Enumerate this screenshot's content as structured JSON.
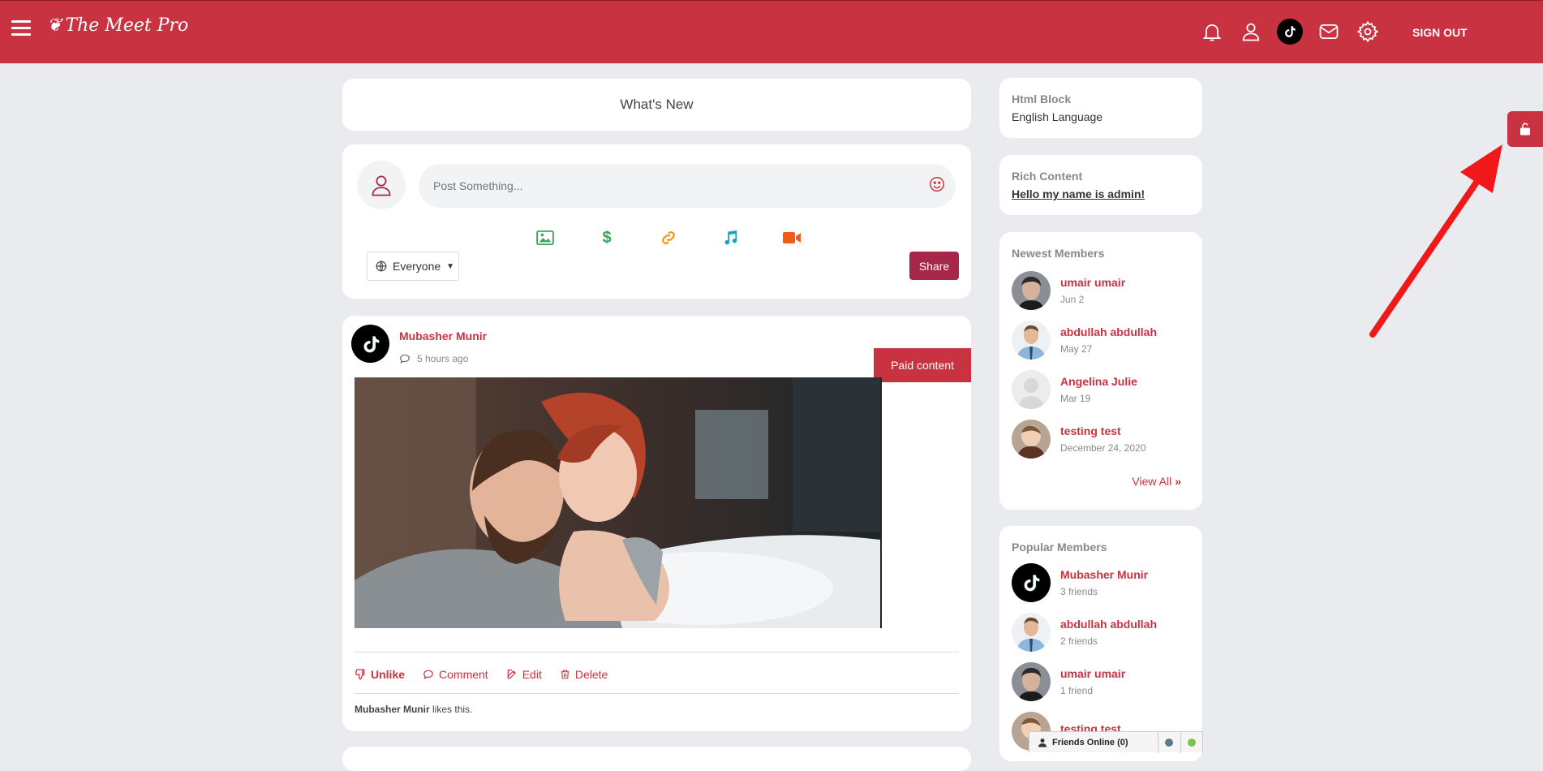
{
  "header": {
    "logo_text": "The Meet Pro",
    "signout_label": "SIGN OUT",
    "icons": [
      "bell-icon",
      "user-icon",
      "tiktok-icon",
      "mail-icon",
      "gear-icon"
    ]
  },
  "main": {
    "whats_new": "What's New",
    "composer": {
      "placeholder": "Post Something...",
      "tools": [
        "image-icon",
        "dollar-icon",
        "link-icon",
        "music-icon",
        "video-icon"
      ],
      "privacy": "Everyone",
      "share_label": "Share"
    },
    "post": {
      "author": "Mubasher Munir",
      "time": "5 hours ago",
      "paid_label": "Paid content",
      "actions": {
        "unlike": "Unlike",
        "comment": "Comment",
        "edit": "Edit",
        "delete": "Delete"
      },
      "likes_name": "Mubasher Munir",
      "likes_suffix": "likes this."
    }
  },
  "sidebar": {
    "html_block": {
      "title": "Html Block",
      "value": "English Language"
    },
    "rich_content": {
      "title": "Rich Content",
      "value": "Hello my name is admin!"
    },
    "newest_members": {
      "title": "Newest Members",
      "items": [
        {
          "name": "umair umair",
          "sub": "Jun 2"
        },
        {
          "name": "abdullah abdullah",
          "sub": "May 27"
        },
        {
          "name": "Angelina Julie",
          "sub": "Mar 19"
        },
        {
          "name": "testing test",
          "sub": "December 24, 2020"
        }
      ],
      "view_all": "View All"
    },
    "popular_members": {
      "title": "Popular Members",
      "items": [
        {
          "name": "Mubasher Munir",
          "sub": "3 friends"
        },
        {
          "name": "abdullah abdullah",
          "sub": "2 friends"
        },
        {
          "name": "umair umair",
          "sub": "1 friend"
        },
        {
          "name": "testing test",
          "sub": ""
        }
      ]
    }
  },
  "friends_bar": {
    "label": "Friends Online (0)"
  },
  "colors": {
    "brand": "#c93240",
    "share": "#a6274a",
    "background": "#e9ebee"
  }
}
